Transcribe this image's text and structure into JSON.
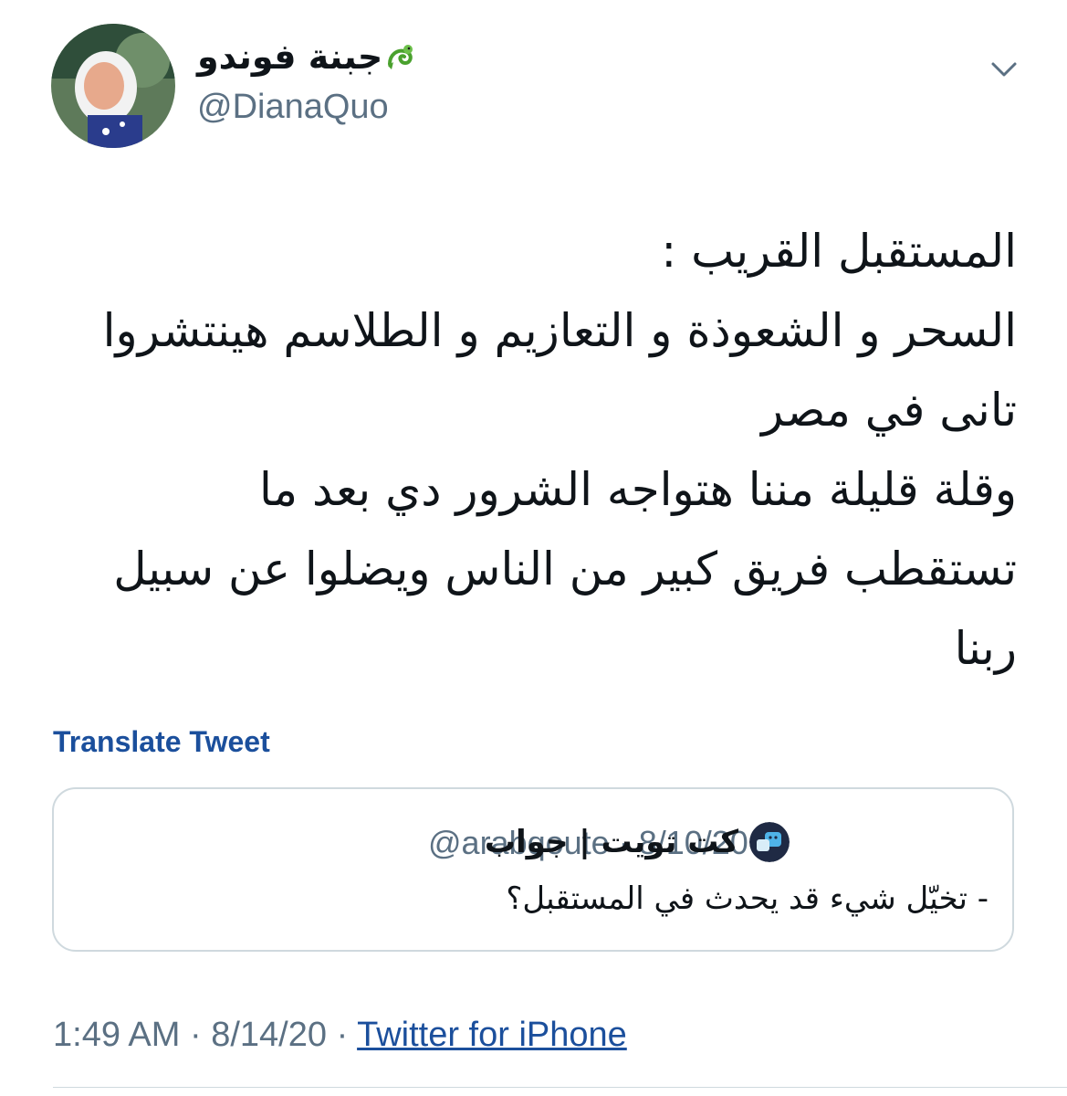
{
  "author": {
    "display_name": "جبنة فوندو",
    "emoji": "dragon-icon",
    "handle": "@DianaQuo"
  },
  "tweet": {
    "lines": [
      "المستقبل القريب :",
      "السحر و الشعوذة و التعازيم و الطلاسم هينتشروا",
      "تانى في مصر",
      "وقلة قليلة مننا هتواجه الشرور دي بعد ما",
      "تستقطب فريق كبير من الناس ويضلوا عن سبيل",
      "ربنا"
    ],
    "translate_label": "Translate Tweet"
  },
  "quoted_tweet": {
    "name": "كت تويت | جواب",
    "handle": "@arabqoute",
    "separator": "·",
    "date": "8/10/20",
    "text": "- تخيّل شيء قد يحدث في المستقبل؟"
  },
  "footer": {
    "time": "1:49 AM",
    "date": "8/14/20",
    "separator": "·",
    "source": "Twitter for iPhone"
  },
  "colors": {
    "link": "#1b4f9c",
    "secondary_text": "#5b7083",
    "border": "#cfd9de"
  }
}
